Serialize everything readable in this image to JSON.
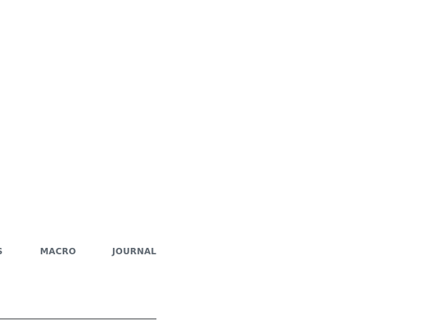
{
  "nav": {
    "items": [
      {
        "label": "S"
      },
      {
        "label": "MACRO"
      },
      {
        "label": "JOURNAL"
      }
    ]
  }
}
